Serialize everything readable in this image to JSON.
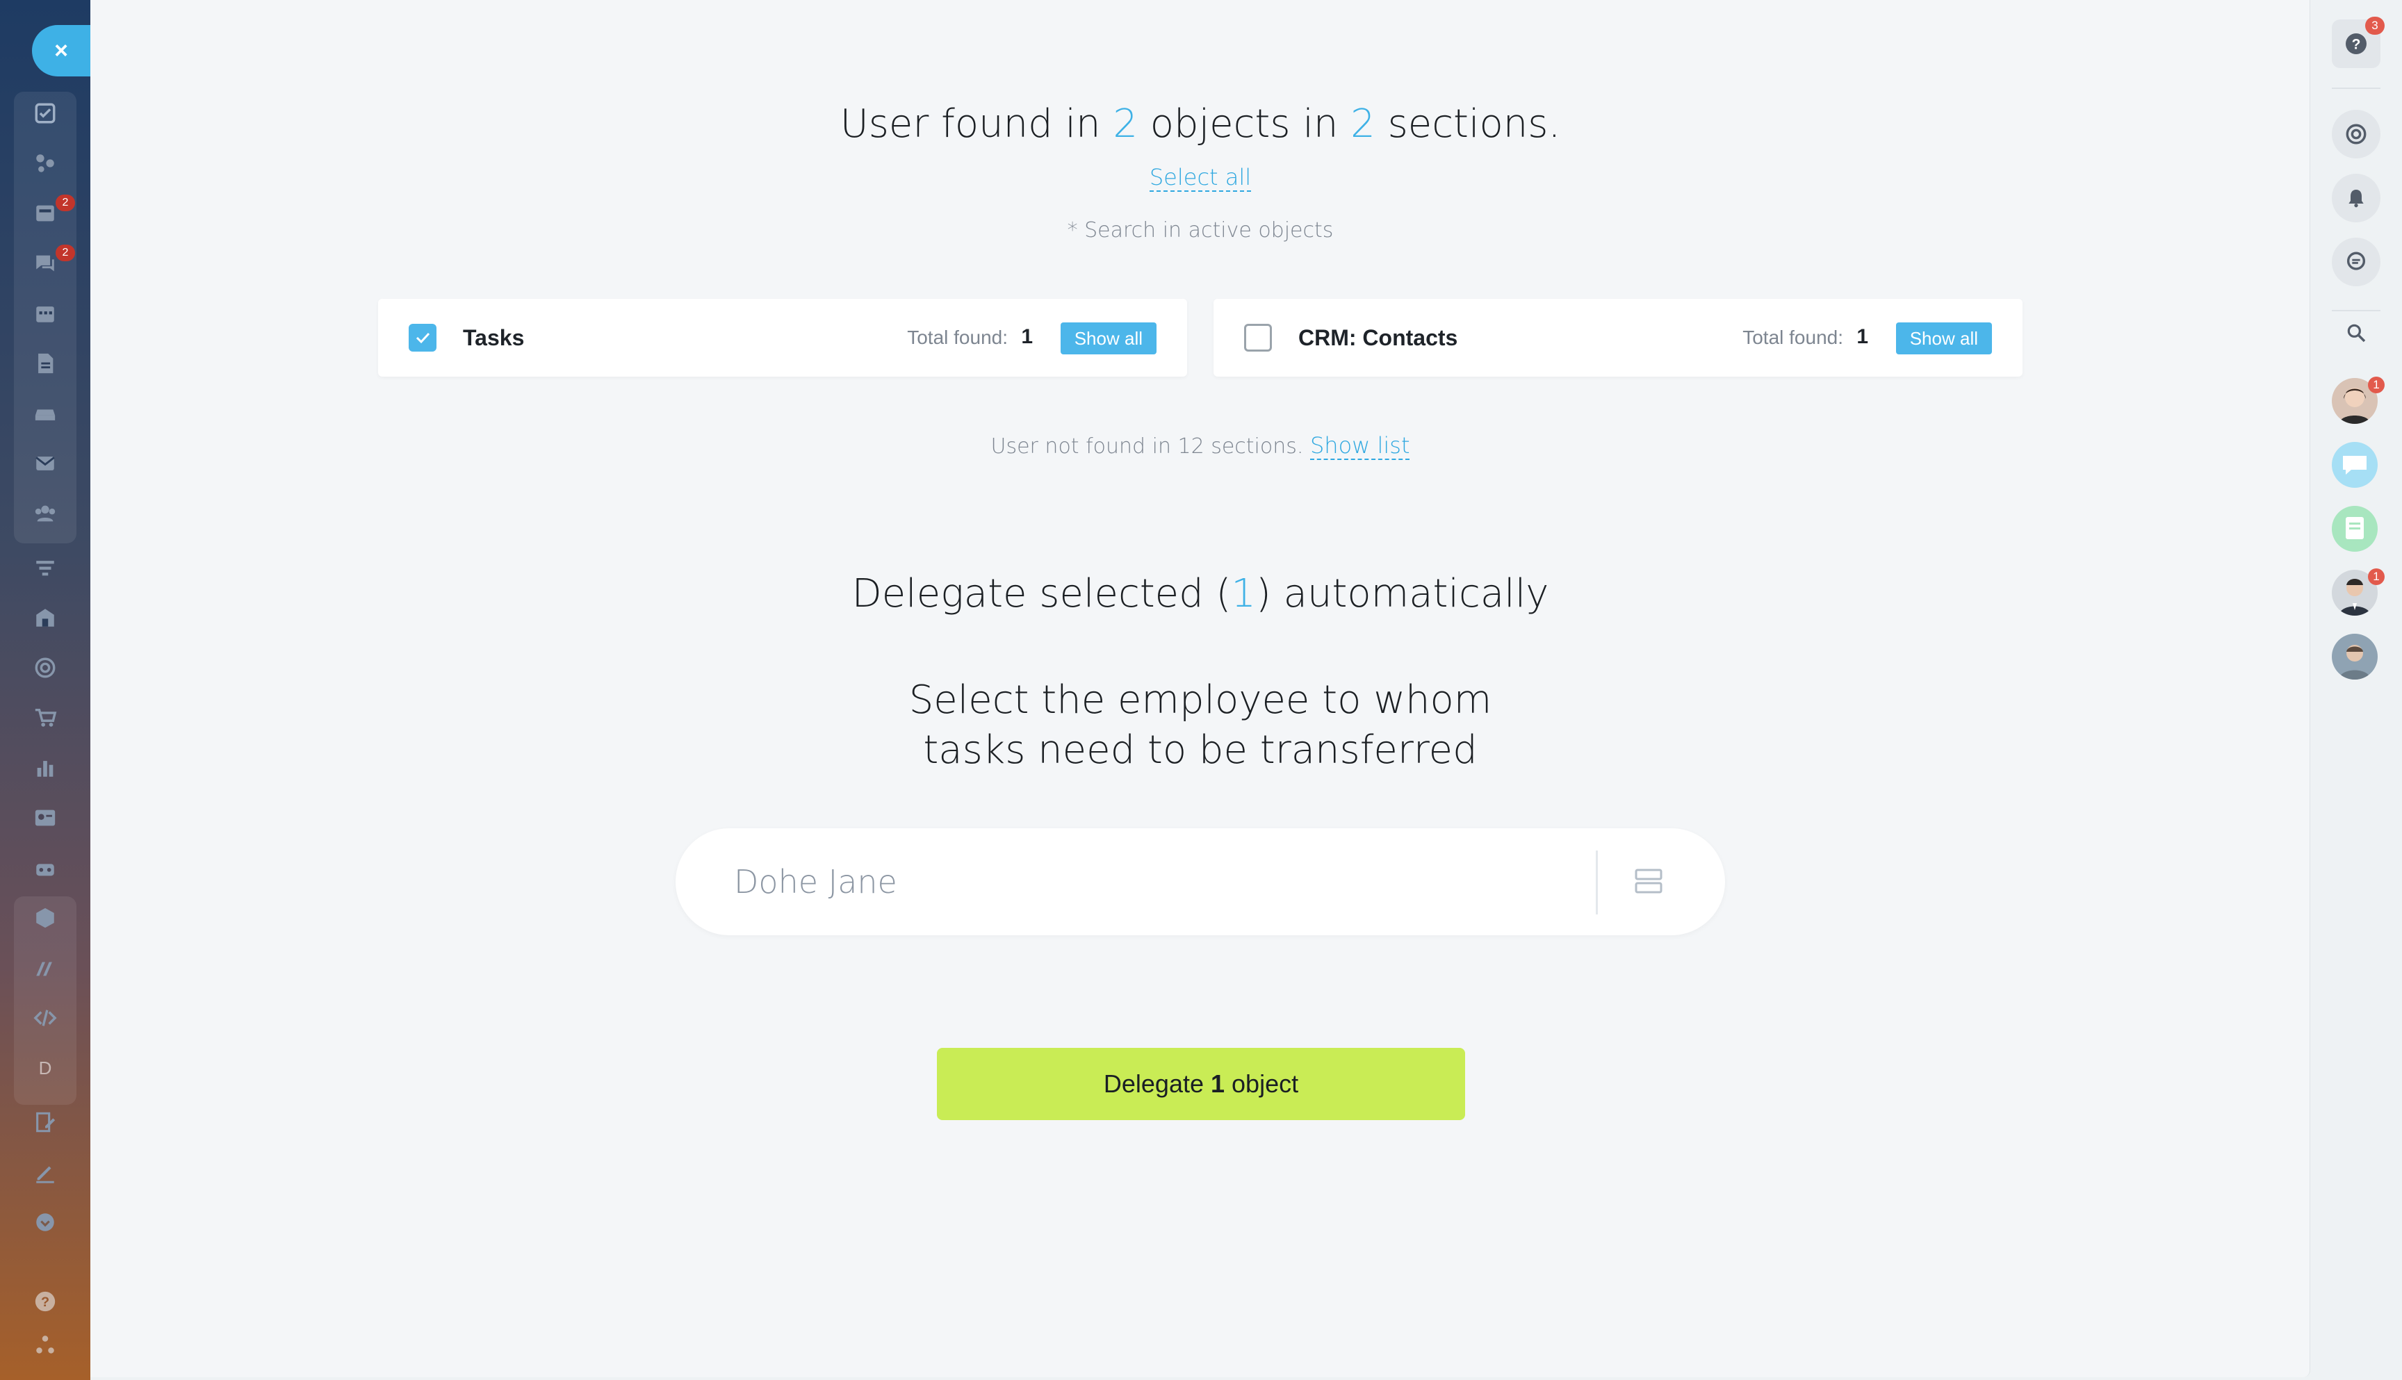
{
  "headline": {
    "prefix": "User found in ",
    "objects_count": "2",
    "middle": " objects in ",
    "sections_count": "2",
    "suffix": " sections."
  },
  "select_all_label": "Select all",
  "search_note": "* Search in active objects",
  "cards": [
    {
      "title": "Tasks",
      "checked": true,
      "total_label": "Total found:",
      "count": "1",
      "show_all_label": "Show all"
    },
    {
      "title": "CRM: Contacts",
      "checked": false,
      "total_label": "Total found:",
      "count": "1",
      "show_all_label": "Show all"
    }
  ],
  "not_found": {
    "text": "User not found in 12 sections. ",
    "link": "Show list"
  },
  "delegate_title": {
    "prefix": "Delegate selected (",
    "count": "1",
    "suffix": ") automatically"
  },
  "select_employee": {
    "line1": "Select the employee to whom",
    "line2": "tasks need to be transferred"
  },
  "employee_input": {
    "value": "Dohe Jane"
  },
  "delegate_button": {
    "prefix": "Delegate ",
    "count": "1",
    "suffix": " object"
  },
  "left_nav": {
    "close_label": "×",
    "badges": [
      "2",
      "2"
    ],
    "letter_item": "D",
    "icons": [
      "tasks-icon",
      "feed-icon",
      "inbox-icon",
      "chat-icon",
      "calendar-icon",
      "documents-icon",
      "drive-icon",
      "mail-icon",
      "groups-icon",
      "filter-icon",
      "store-icon",
      "target-icon",
      "cart-icon",
      "analytics-icon",
      "contact-card-icon",
      "robot-icon",
      "box-icon",
      "brand-icon",
      "code-icon",
      "sign-icon",
      "pen-icon",
      "more-icon",
      "help-icon",
      "sitemap-icon"
    ]
  },
  "right_bar": {
    "help_badge": "3",
    "avatar_badges": [
      "1",
      "1"
    ],
    "icons": [
      "help-icon",
      "at-mention-icon",
      "bell-icon",
      "chat-bubble-icon",
      "search-icon"
    ]
  },
  "colors": {
    "accent": "#3eb1e6",
    "button": "#c9ec55",
    "badge": "#c2352b"
  }
}
